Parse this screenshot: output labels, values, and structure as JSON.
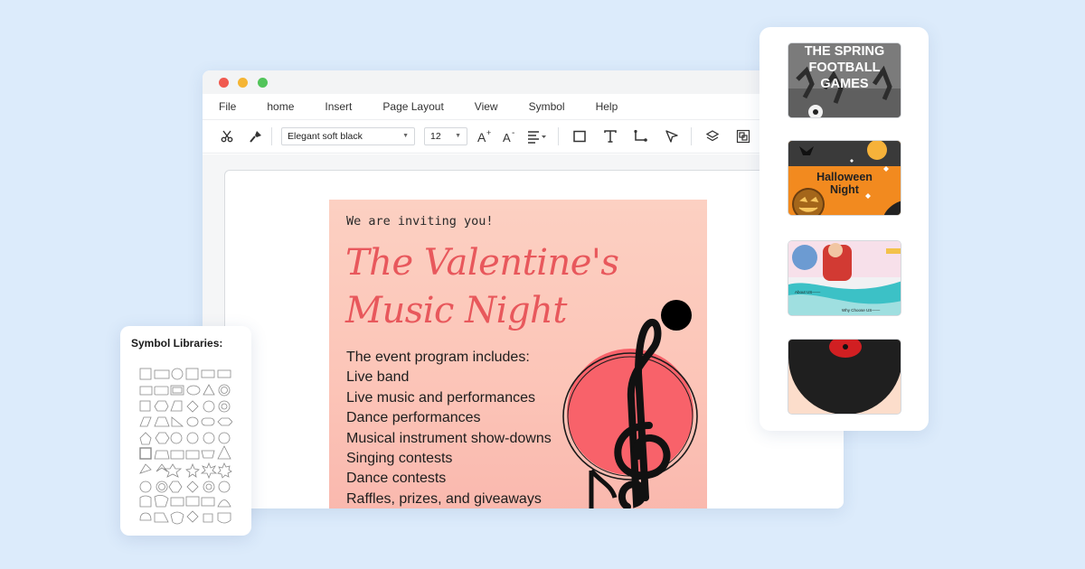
{
  "window": {
    "menu": [
      "File",
      "home",
      "Insert",
      "Page Layout",
      "View",
      "Symbol",
      "Help"
    ],
    "toolbar": {
      "font_family": "Elegant soft black",
      "font_size": "12",
      "icons": [
        "cut-icon",
        "format-painter-icon",
        "font-increase-icon",
        "font-decrease-icon",
        "align-icon",
        "rectangle-icon",
        "text-icon",
        "connector-icon",
        "pointer-icon",
        "layers-icon",
        "group-icon"
      ]
    }
  },
  "poster": {
    "invite": "We are inviting you!",
    "title_line1": "The Valentine's",
    "title_line2": "Music Night",
    "program": [
      "The event program includes:",
      "Live band",
      "Live music and performances",
      "Dance performances",
      "Musical instrument show-downs",
      "Singing contests",
      "Dance contests",
      "Raffles, prizes, and giveaways"
    ]
  },
  "templates": [
    {
      "name": "spring-football",
      "text": "THE SPRING FOOTBALL GAMES"
    },
    {
      "name": "halloween",
      "text_line1": "Halloween",
      "text_line2": "Night"
    },
    {
      "name": "school",
      "text_line1": "About US——",
      "text_line2": "Why Choose US——"
    },
    {
      "name": "vinyl",
      "text": ""
    }
  ],
  "symbols": {
    "title": "Symbol Libraries:"
  },
  "colors": {
    "background": "#dcebfb",
    "accent_red": "#e8585c",
    "poster_bg": "#fcc5b8"
  }
}
